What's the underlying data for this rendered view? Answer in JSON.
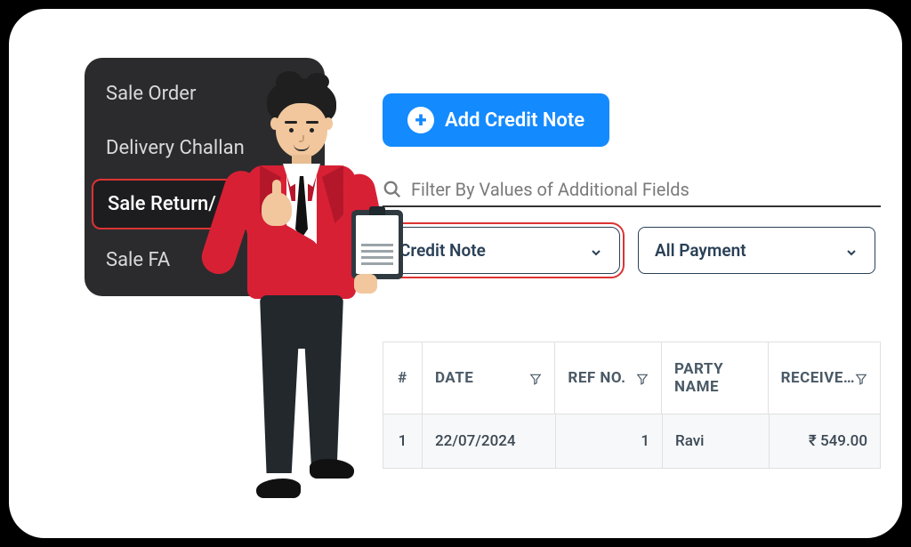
{
  "sidebar": {
    "items": [
      {
        "label": "Sale Order"
      },
      {
        "label": "Delivery Challan"
      },
      {
        "label": "Sale Return/ Cr."
      },
      {
        "label": "Sale FA"
      }
    ],
    "active_index": 2
  },
  "main": {
    "add_button_label": "Add Credit Note",
    "search_placeholder": "Filter By Values of Additional Fields",
    "filter_type": {
      "selected": "Credit Note"
    },
    "filter_payment": {
      "selected": "All Payment"
    }
  },
  "table": {
    "columns": {
      "idx": "#",
      "date": "DATE",
      "ref": "REF NO.",
      "party": "PARTY NAME",
      "received": "RECEIVE…"
    },
    "rows": [
      {
        "idx": "1",
        "date": "22/07/2024",
        "ref": "1",
        "party": "Ravi",
        "received": "₹ 549.00"
      }
    ]
  }
}
